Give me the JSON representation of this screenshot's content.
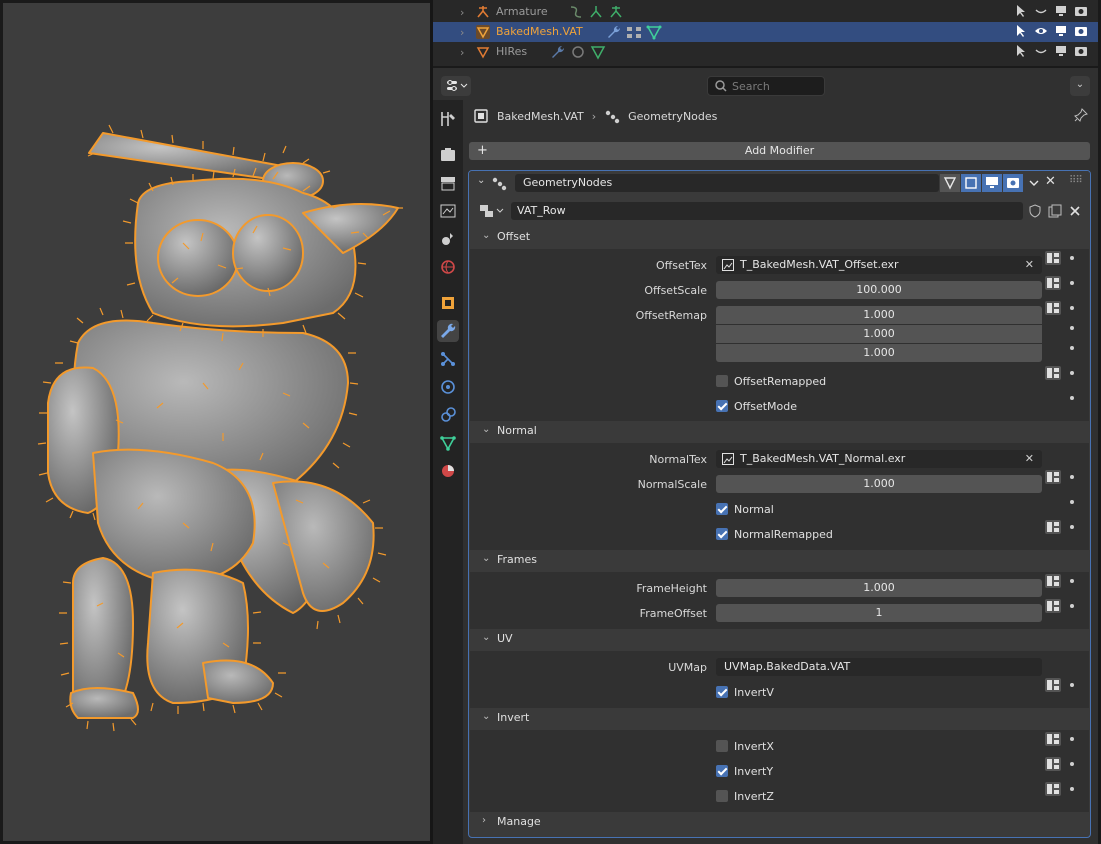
{
  "outliner": {
    "rows": [
      {
        "label": "Armature",
        "selected": false
      },
      {
        "label": "BakedMesh.VAT",
        "selected": true
      },
      {
        "label": "HIRes",
        "selected": false
      }
    ]
  },
  "header": {
    "search_placeholder": "Search"
  },
  "breadcrumb": {
    "object": "BakedMesh.VAT",
    "modifier": "GeometryNodes"
  },
  "add_modifier_label": "Add Modifier",
  "modifier": {
    "name": "GeometryNodes",
    "node_group": "VAT_Row"
  },
  "sections": {
    "offset": "Offset",
    "normal": "Normal",
    "frames": "Frames",
    "uv": "UV",
    "invert": "Invert",
    "manage": "Manage"
  },
  "offset": {
    "tex_label": "OffsetTex",
    "tex_value": "T_BakedMesh.VAT_Offset.exr",
    "scale_label": "OffsetScale",
    "scale_value": "100.000",
    "remap_label": "OffsetRemap",
    "remap_values": [
      "1.000",
      "1.000",
      "1.000"
    ],
    "remapped_label": "OffsetRemapped",
    "remapped_checked": false,
    "mode_label": "OffsetMode",
    "mode_checked": true
  },
  "normal": {
    "tex_label": "NormalTex",
    "tex_value": "T_BakedMesh.VAT_Normal.exr",
    "scale_label": "NormalScale",
    "scale_value": "1.000",
    "normal_label": "Normal",
    "normal_checked": true,
    "remapped_label": "NormalRemapped",
    "remapped_checked": true
  },
  "frames": {
    "height_label": "FrameHeight",
    "height_value": "1.000",
    "offset_label": "FrameOffset",
    "offset_value": "1"
  },
  "uv": {
    "map_label": "UVMap",
    "map_value": "UVMap.BakedData.VAT",
    "invertv_label": "InvertV",
    "invertv_checked": true
  },
  "invert": {
    "x_label": "InvertX",
    "x_checked": false,
    "y_label": "InvertY",
    "y_checked": true,
    "z_label": "InvertZ",
    "z_checked": false
  },
  "colors": {
    "selection": "#334d80",
    "accent": "#4772b3",
    "mesh_outline": "#f39a2c",
    "active_text": "#f0a33a"
  }
}
